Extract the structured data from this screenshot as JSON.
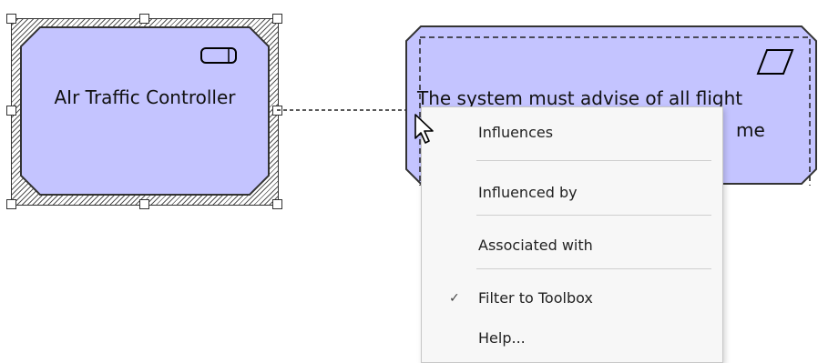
{
  "diagram": {
    "actor_node": {
      "label": "AIr Traffic Controller",
      "icon": "actor-icon"
    },
    "requirement_node": {
      "label_line1": "The system must advise of all flight",
      "label_line2": "me",
      "icon": "requirement-icon"
    },
    "colors": {
      "node_fill": "#c4c4ff",
      "node_border": "#333333"
    }
  },
  "context_menu": {
    "items": [
      {
        "label": "Influences",
        "checked": false
      },
      {
        "label": "Influenced by",
        "checked": false
      },
      {
        "label": "Associated with",
        "checked": false
      },
      {
        "label": "Filter to Toolbox",
        "checked": true
      },
      {
        "label": "Help...",
        "checked": false
      }
    ],
    "check_glyph": "✓"
  }
}
